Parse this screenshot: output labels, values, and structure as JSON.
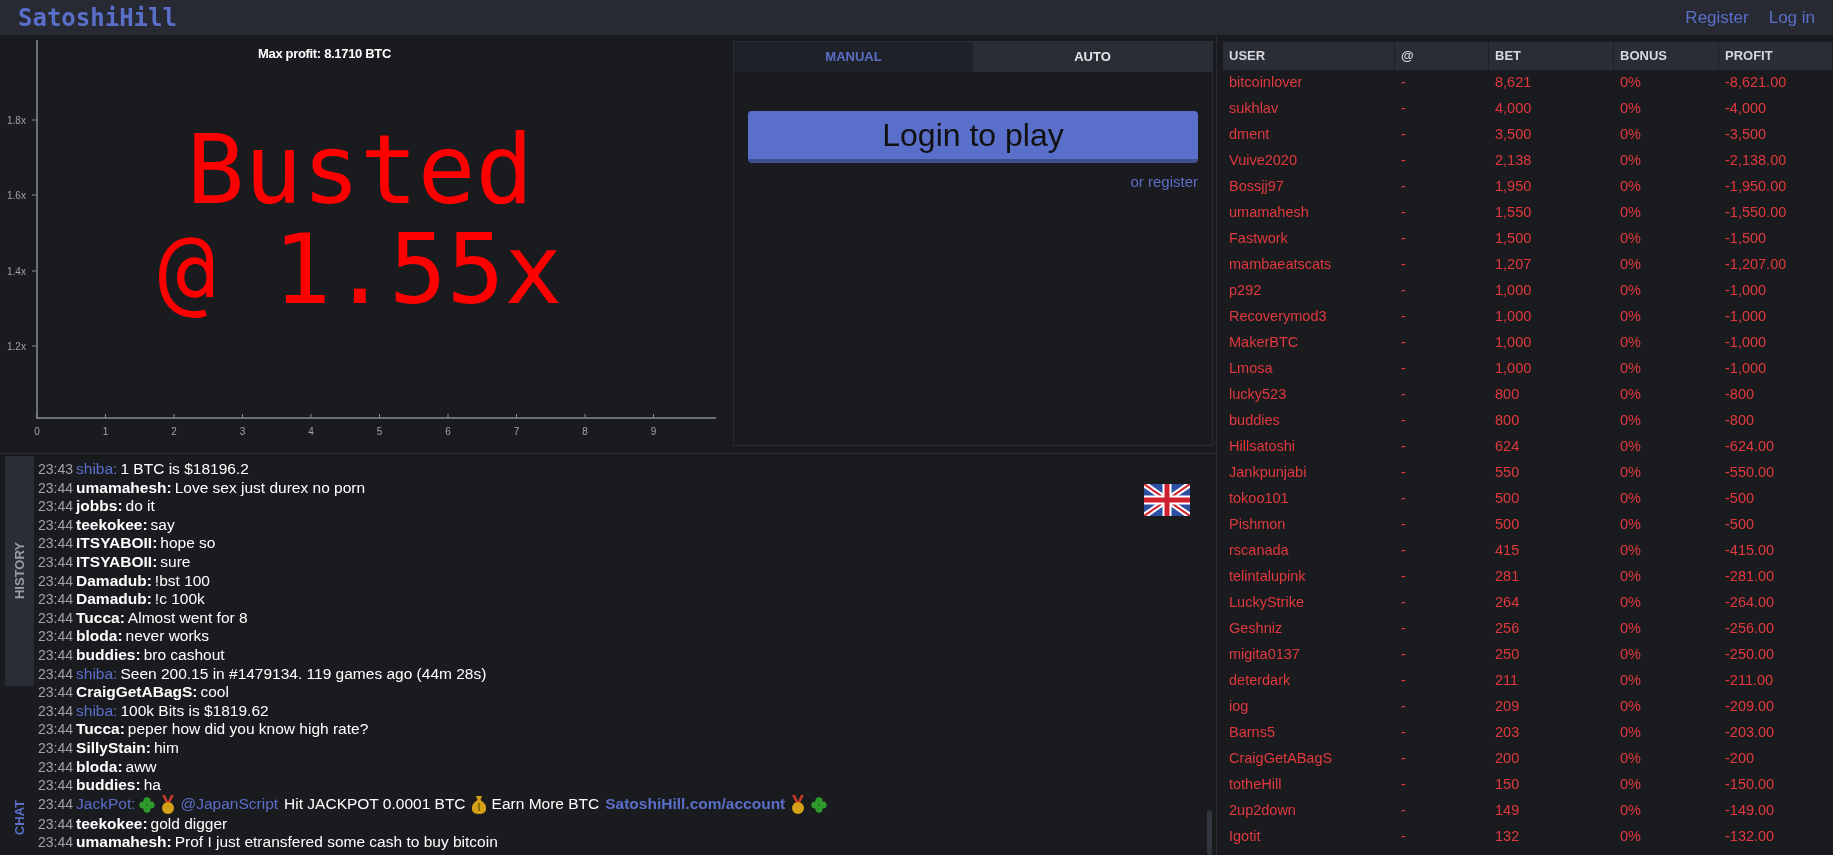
{
  "header": {
    "logo": "SatoshiHill",
    "links": [
      "Register",
      "Log in"
    ]
  },
  "chart": {
    "max_profit": "Max profit: 8.1710 BTC",
    "y_axis_labels": [
      "1.8x",
      "1.6x",
      "1.4x",
      "1.2x"
    ],
    "x_axis_labels": [
      "0",
      "1",
      "2",
      "3",
      "4",
      "5",
      "6",
      "7",
      "8",
      "9"
    ],
    "status_lines": [
      "Busted",
      "@ 1.55x"
    ]
  },
  "controls": {
    "tabs": [
      {
        "label": "MANUAL",
        "selected": true
      },
      {
        "label": "AUTO",
        "selected": false
      }
    ],
    "login_button": "Login to play",
    "register_link": "or register"
  },
  "side_tabs": [
    {
      "label": "HISTORY",
      "selected": false
    },
    {
      "label": "CHAT",
      "selected": true
    }
  ],
  "chat": [
    {
      "time": "23:43",
      "user": "shiba:",
      "kind": "bot",
      "parts": [
        {
          "kind": "plain",
          "text": "1 BTC is $18196.2"
        }
      ]
    },
    {
      "time": "23:44",
      "user": "umamahesh:",
      "kind": "user",
      "parts": [
        {
          "kind": "plain",
          "text": "Love sex just durex no porn"
        }
      ]
    },
    {
      "time": "23:44",
      "user": "jobbs:",
      "kind": "user",
      "parts": [
        {
          "kind": "plain",
          "text": "do it"
        }
      ]
    },
    {
      "time": "23:44",
      "user": "teekokee:",
      "kind": "user",
      "parts": [
        {
          "kind": "plain",
          "text": "say"
        }
      ]
    },
    {
      "time": "23:44",
      "user": "ITSYABOII:",
      "kind": "user",
      "parts": [
        {
          "kind": "plain",
          "text": "hope so"
        }
      ]
    },
    {
      "time": "23:44",
      "user": "ITSYABOII:",
      "kind": "user",
      "parts": [
        {
          "kind": "plain",
          "text": "sure"
        }
      ]
    },
    {
      "time": "23:44",
      "user": "Damadub:",
      "kind": "user",
      "parts": [
        {
          "kind": "plain",
          "text": "!bst 100"
        }
      ]
    },
    {
      "time": "23:44",
      "user": "Damadub:",
      "kind": "user",
      "parts": [
        {
          "kind": "plain",
          "text": "!c 100k"
        }
      ]
    },
    {
      "time": "23:44",
      "user": "Tucca:",
      "kind": "user",
      "parts": [
        {
          "kind": "plain",
          "text": "Almost went for 8"
        }
      ]
    },
    {
      "time": "23:44",
      "user": "bloda:",
      "kind": "user",
      "parts": [
        {
          "kind": "plain",
          "text": "never works"
        }
      ]
    },
    {
      "time": "23:44",
      "user": "buddies:",
      "kind": "user",
      "parts": [
        {
          "kind": "plain",
          "text": "bro cashout"
        }
      ]
    },
    {
      "time": "23:44",
      "user": "shiba:",
      "kind": "bot",
      "parts": [
        {
          "kind": "plain",
          "text": "Seen 200.15 in #1479134. 119 games ago (44m 28s)"
        }
      ]
    },
    {
      "time": "23:44",
      "user": "CraigGetABagS:",
      "kind": "user",
      "parts": [
        {
          "kind": "plain",
          "text": "cool"
        }
      ]
    },
    {
      "time": "23:44",
      "user": "shiba:",
      "kind": "bot",
      "parts": [
        {
          "kind": "plain",
          "text": "100k Bits is $1819.62"
        }
      ]
    },
    {
      "time": "23:44",
      "user": "Tucca:",
      "kind": "user",
      "parts": [
        {
          "kind": "plain",
          "text": "peper how did you know high rate?"
        }
      ]
    },
    {
      "time": "23:44",
      "user": "SillyStain:",
      "kind": "user",
      "parts": [
        {
          "kind": "plain",
          "text": "him"
        }
      ]
    },
    {
      "time": "23:44",
      "user": "bloda:",
      "kind": "user",
      "parts": [
        {
          "kind": "plain",
          "text": "aww"
        }
      ]
    },
    {
      "time": "23:44",
      "user": "buddies:",
      "kind": "user",
      "parts": [
        {
          "kind": "plain",
          "text": "ha"
        }
      ]
    },
    {
      "time": "23:44",
      "user": "JackPot:",
      "kind": "bot",
      "parts": [
        {
          "kind": "clover"
        },
        {
          "kind": "medal"
        },
        {
          "kind": "mention",
          "text": "@JapanScript"
        },
        {
          "kind": "plain",
          "text": "Hit JACKPOT 0.0001 BTC"
        },
        {
          "kind": "money-bag"
        },
        {
          "kind": "plain",
          "text": "Earn More BTC"
        },
        {
          "kind": "link",
          "text": "SatoshiHill.com/account"
        },
        {
          "kind": "medal"
        },
        {
          "kind": "clover"
        }
      ]
    },
    {
      "time": "23:44",
      "user": "teekokee:",
      "kind": "user",
      "parts": [
        {
          "kind": "plain",
          "text": "gold digger"
        }
      ]
    },
    {
      "time": "23:44",
      "user": "umamahesh:",
      "kind": "user",
      "parts": [
        {
          "kind": "plain",
          "text": "Prof I just etransfered some cash to buy bitcoin"
        }
      ]
    }
  ],
  "players": {
    "columns": [
      "USER",
      "@",
      "BET",
      "BONUS",
      "PROFIT"
    ],
    "rows": [
      [
        "bitcoinlover",
        "-",
        "8,621",
        "0%",
        "-8,621.00"
      ],
      [
        "sukhlav",
        "-",
        "4,000",
        "0%",
        "-4,000"
      ],
      [
        "dment",
        "-",
        "3,500",
        "0%",
        "-3,500"
      ],
      [
        "Vuive2020",
        "-",
        "2,138",
        "0%",
        "-2,138.00"
      ],
      [
        "Bossjj97",
        "-",
        "1,950",
        "0%",
        "-1,950.00"
      ],
      [
        "umamahesh",
        "-",
        "1,550",
        "0%",
        "-1,550.00"
      ],
      [
        "Fastwork",
        "-",
        "1,500",
        "0%",
        "-1,500"
      ],
      [
        "mambaeatscats",
        "-",
        "1,207",
        "0%",
        "-1,207.00"
      ],
      [
        "p292",
        "-",
        "1,000",
        "0%",
        "-1,000"
      ],
      [
        "Recoverymod3",
        "-",
        "1,000",
        "0%",
        "-1,000"
      ],
      [
        "MakerBTC",
        "-",
        "1,000",
        "0%",
        "-1,000"
      ],
      [
        "Lmosa",
        "-",
        "1,000",
        "0%",
        "-1,000"
      ],
      [
        "lucky523",
        "-",
        "800",
        "0%",
        "-800"
      ],
      [
        "buddies",
        "-",
        "800",
        "0%",
        "-800"
      ],
      [
        "Hillsatoshi",
        "-",
        "624",
        "0%",
        "-624.00"
      ],
      [
        "Jankpunjabi",
        "-",
        "550",
        "0%",
        "-550.00"
      ],
      [
        "tokoo101",
        "-",
        "500",
        "0%",
        "-500"
      ],
      [
        "Pishmon",
        "-",
        "500",
        "0%",
        "-500"
      ],
      [
        "rscanada",
        "-",
        "415",
        "0%",
        "-415.00"
      ],
      [
        "telintalupink",
        "-",
        "281",
        "0%",
        "-281.00"
      ],
      [
        "LuckyStrike",
        "-",
        "264",
        "0%",
        "-264.00"
      ],
      [
        "Geshniz",
        "-",
        "256",
        "0%",
        "-256.00"
      ],
      [
        "migita0137",
        "-",
        "250",
        "0%",
        "-250.00"
      ],
      [
        "deterdark",
        "-",
        "211",
        "0%",
        "-211.00"
      ],
      [
        "iog",
        "-",
        "209",
        "0%",
        "-209.00"
      ],
      [
        "Barns5",
        "-",
        "203",
        "0%",
        "-203.00"
      ],
      [
        "CraigGetABagS",
        "-",
        "200",
        "0%",
        "-200"
      ],
      [
        "totheHill",
        "-",
        "150",
        "0%",
        "-150.00"
      ],
      [
        "2up2down",
        "-",
        "149",
        "0%",
        "-149.00"
      ],
      [
        "Igotit",
        "-",
        "132",
        "0%",
        "-132.00"
      ]
    ]
  }
}
